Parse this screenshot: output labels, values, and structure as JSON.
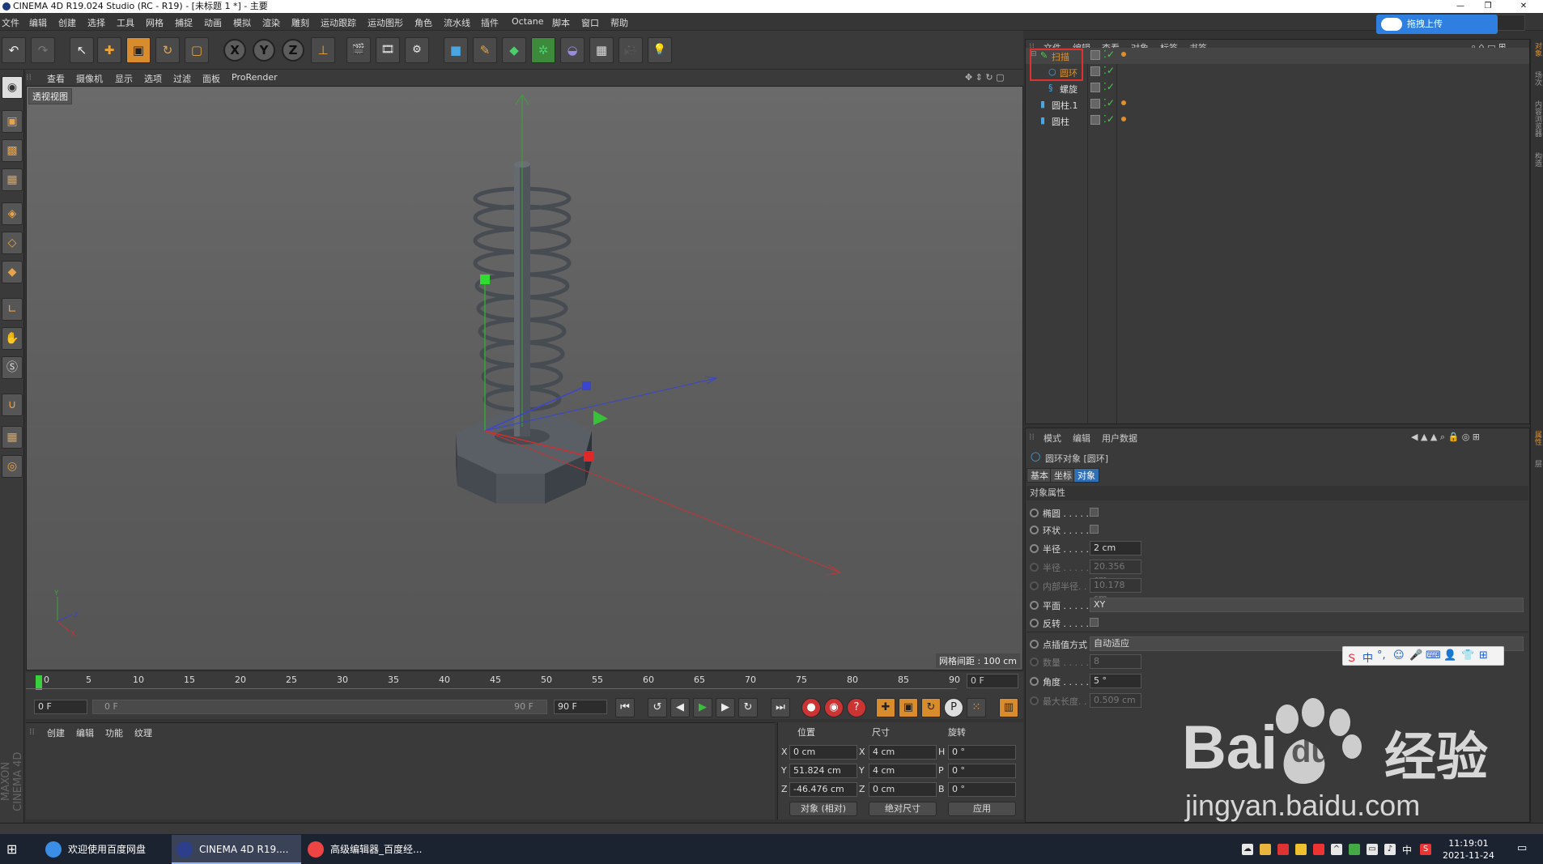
{
  "window": {
    "title": "CINEMA 4D R19.024 Studio (RC - R19) - [未标题 1 *] - 主要"
  },
  "menu": [
    "文件",
    "编辑",
    "创建",
    "选择",
    "工具",
    "网格",
    "捕捉",
    "动画",
    "模拟",
    "渲染",
    "雕刻",
    "运动跟踪",
    "运动图形",
    "角色",
    "流水线",
    "插件",
    "Octane",
    "脚本",
    "窗口",
    "帮助"
  ],
  "upload": {
    "label": "拖拽上传"
  },
  "toolbar": {
    "undo": "↶",
    "redo": "↷",
    "select": "↖",
    "move": "✚",
    "scale": "▣",
    "rotate": "↻",
    "last": "▢",
    "x": "X",
    "y": "Y",
    "z": "Z",
    "coord": "⊥",
    "render_view": "🎬",
    "render_pic": "🎞",
    "render_settings": "⚙",
    "cube": "■",
    "pen": "✎",
    "subdiv": "◆",
    "cloner": "✲",
    "deformer": "◒",
    "floor": "▦",
    "camera": "🎥",
    "light": "💡"
  },
  "viewport": {
    "menu": [
      "查看",
      "摄像机",
      "显示",
      "选项",
      "过滤",
      "面板",
      "ProRender"
    ],
    "label": "透视视图",
    "grid_spacing": "网格间距 : 100 cm"
  },
  "timeline": {
    "ticks": [
      "0",
      "5",
      "10",
      "15",
      "20",
      "25",
      "30",
      "35",
      "40",
      "45",
      "50",
      "55",
      "60",
      "65",
      "70",
      "75",
      "80",
      "85",
      "90"
    ],
    "current_frame": "0 F"
  },
  "playback": {
    "start_field": "0 F",
    "range_start": "0 F",
    "range_end": "90 F",
    "end_field": "90 F"
  },
  "material_manager": {
    "menu": [
      "创建",
      "编辑",
      "功能",
      "纹理"
    ]
  },
  "coordinates": {
    "headers": {
      "position": "位置",
      "size": "尺寸",
      "rotation": "旋转"
    },
    "rows": [
      {
        "axis": "X",
        "pos": "0 cm",
        "saxis": "X",
        "size": "4 cm",
        "raxis": "H",
        "rot": "0 °"
      },
      {
        "axis": "Y",
        "pos": "51.824 cm",
        "saxis": "Y",
        "size": "4 cm",
        "raxis": "P",
        "rot": "0 °"
      },
      {
        "axis": "Z",
        "pos": "-46.476 cm",
        "saxis": "Z",
        "size": "0 cm",
        "raxis": "B",
        "rot": "0 °"
      }
    ],
    "mode": "对象 (相对)",
    "size_mode": "绝对尺寸",
    "apply": "应用"
  },
  "object_manager": {
    "menu": [
      "文件",
      "编辑",
      "查看",
      "对象",
      "标签",
      "书签"
    ],
    "objects": [
      {
        "name": "扫描",
        "indent": 0,
        "tag": true,
        "selected": true,
        "color": "#e0902a"
      },
      {
        "name": "圆环",
        "indent": 1,
        "tag": false,
        "selected": false,
        "color": "#e0902a"
      },
      {
        "name": "螺旋",
        "indent": 1,
        "tag": false,
        "selected": false,
        "color": "#ddd"
      },
      {
        "name": "圆柱.1",
        "indent": 0,
        "tag": true,
        "selected": false,
        "color": "#ddd"
      },
      {
        "name": "圆柱",
        "indent": 0,
        "tag": true,
        "selected": false,
        "color": "#ddd"
      }
    ]
  },
  "attributes": {
    "menu": [
      "模式",
      "编辑",
      "用户数据"
    ],
    "object_title": "圆环对象 [圆环]",
    "tabs": [
      "基本",
      "坐标",
      "对象"
    ],
    "section": "对象属性",
    "props": [
      {
        "label": "椭圆 . . . . .",
        "type": "check",
        "dim": false
      },
      {
        "label": "环状 . . . . .",
        "type": "check",
        "dim": false
      },
      {
        "label": "半径 . . . . .",
        "type": "field",
        "value": "2 cm",
        "dim": false
      },
      {
        "label": "半径 . . . . .",
        "type": "field",
        "value": "20.356 cm",
        "dim": true
      },
      {
        "label": "内部半径. . .",
        "type": "field",
        "value": "10.178 cm",
        "dim": true
      },
      {
        "label": "平面 . . . . .",
        "type": "select",
        "value": "XY",
        "dim": false
      },
      {
        "label": "反转 . . . . .",
        "type": "check",
        "dim": false
      },
      {
        "label": "点插值方式",
        "type": "select",
        "value": "自动适应",
        "dim": false
      },
      {
        "label": "数量 . . . . .",
        "type": "field",
        "value": "8",
        "dim": true
      },
      {
        "label": "角度 . . . . .",
        "type": "field",
        "value": "5 °",
        "dim": false
      },
      {
        "label": "最大长度. . .",
        "type": "field",
        "value": "0.509 cm",
        "dim": true
      }
    ]
  },
  "right_tabs": [
    "对象",
    "场次",
    "内容浏览器",
    "构造"
  ],
  "right_tabs_lower": [
    "属性",
    "层"
  ],
  "side_logo": "MAXON CINEMA 4D",
  "ime": {
    "lang": "中"
  },
  "watermark": {
    "brand": "Bai",
    "brand2": "du",
    "cn": "经验",
    "url": "jingyan.baidu.com"
  },
  "taskbar": {
    "tasks": [
      {
        "label": "欢迎使用百度网盘",
        "color": "#3a8ee6"
      },
      {
        "label": "CINEMA 4D R19....",
        "color": "#2d3e8a"
      },
      {
        "label": "高级编辑器_百度经...",
        "color": "#e44"
      }
    ],
    "ime": "中",
    "time": "11:19:01",
    "date": "2021-11-24"
  }
}
